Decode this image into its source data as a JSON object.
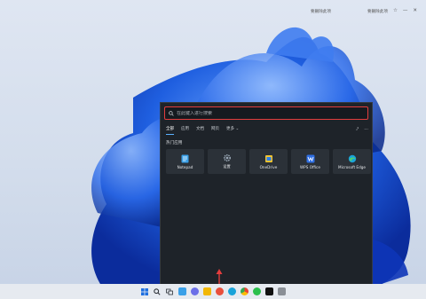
{
  "topbar": {
    "left_text": "要删除此项",
    "right_text": "要删除此项",
    "icons": [
      "star-icon",
      "minimize-icon",
      "close-icon"
    ]
  },
  "search": {
    "placeholder": "在此键入进行搜索",
    "value": ""
  },
  "tabs": [
    {
      "label": "全部",
      "active": true
    },
    {
      "label": "应用",
      "active": false
    },
    {
      "label": "文档",
      "active": false
    },
    {
      "label": "网页",
      "active": false
    },
    {
      "label": "更多",
      "active": false
    }
  ],
  "tools": [
    "share-icon",
    "more-icon"
  ],
  "section_title": "热门应用",
  "apps": [
    {
      "label": "Notepad",
      "icon": "notepad-icon"
    },
    {
      "label": "设置",
      "icon": "settings-icon"
    },
    {
      "label": "OneDrive",
      "icon": "onedrive-icon"
    },
    {
      "label": "WPS Office",
      "icon": "wps-icon"
    },
    {
      "label": "Microsoft Edge",
      "icon": "edge-icon"
    }
  ],
  "taskbar": {
    "icons": [
      "windows-icon",
      "search-icon",
      "task-view-icon",
      "widgets-icon",
      "chat-icon",
      "explorer-icon",
      "store-icon",
      "edge-icon",
      "chrome-icon",
      "wechat-icon",
      "tiktok-icon",
      "app-icon"
    ]
  },
  "colors": {
    "accent": "#e23d3d",
    "panel": "#1e2329",
    "wallpaper_blue": "#1f5fe0"
  }
}
